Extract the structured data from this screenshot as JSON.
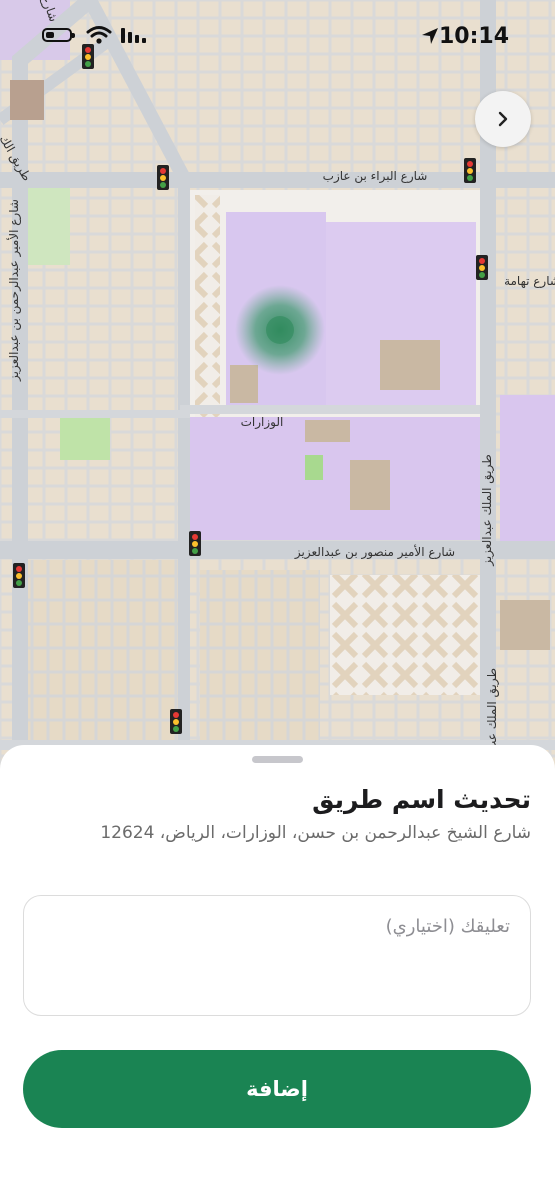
{
  "status_bar": {
    "time": "10:14"
  },
  "map": {
    "street_labels": {
      "bara": "شارع البراء بن عازب",
      "tihama": "شارع تهامة",
      "wizarat": "الوزارات",
      "mansour": "شارع الأمير منصور بن عبدالعزيز",
      "abdulrahman": "شارع الأمير عبدالرحمن بن عبدالعزيز",
      "king_abdulaziz": "طريق الملك عبدالعزيز",
      "king_abdulaziz_lower": "طريق الملك عب",
      "top_left": "شارع",
      "top_left_2": "طريق الك"
    },
    "colors": {
      "block": "#e7dccb",
      "road": "#cdd1d6",
      "ministry": "#d9c6ee",
      "park": "#bfe3a8",
      "location": "#2e8a5c"
    }
  },
  "sheet": {
    "title": "تحديث اسم طريق",
    "address": "شارع الشيخ عبدالرحمن بن حسن، الوزارات، الرياض، 12624",
    "comment_placeholder": "تعليقك (اختياري)",
    "comment_value": "",
    "add_button_label": "إضافة"
  },
  "colors": {
    "accent": "#1a8453"
  }
}
